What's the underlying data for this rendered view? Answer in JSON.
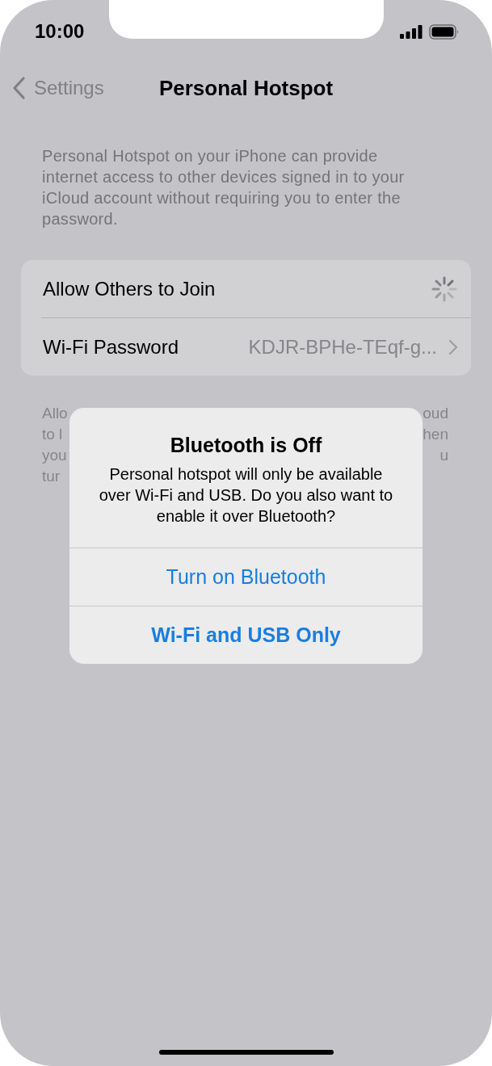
{
  "status_bar": {
    "time": "10:00"
  },
  "nav": {
    "back": "Settings",
    "title": "Personal Hotspot"
  },
  "description": "Personal Hotspot on your iPhone can provide internet access to other devices signed in to your iCloud account without requiring you to enter the password.",
  "settings": [
    {
      "kind": "loading",
      "label": "Allow Others to Join"
    },
    {
      "kind": "link",
      "label": "Wi-Fi Password",
      "value": "KDJR-BPHe-TEqf-g..."
    }
  ],
  "footer_fragments": [
    {
      "left": "Allo",
      "right": "oud"
    },
    {
      "left": "to l",
      "right": "hen"
    },
    {
      "left": "you",
      "right": "u"
    },
    {
      "left": "tur"
    }
  ],
  "alert": {
    "title": "Bluetooth is Off",
    "message": "Personal hotspot will only be available over Wi-Fi and USB. Do you also want to enable it over Bluetooth?",
    "buttons": [
      {
        "label": "Turn on Bluetooth",
        "kind": "default"
      },
      {
        "label": "Wi-Fi and USB Only",
        "kind": "preferred"
      }
    ]
  }
}
